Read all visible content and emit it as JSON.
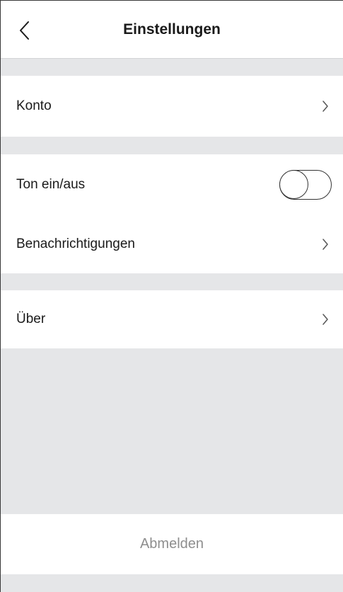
{
  "header": {
    "title": "Einstellungen"
  },
  "sections": {
    "account": {
      "label": "Konto"
    },
    "sound": {
      "label": "Ton ein/aus",
      "enabled": false
    },
    "notifications": {
      "label": "Benachrichtigungen"
    },
    "about": {
      "label": "Über"
    }
  },
  "logout": {
    "label": "Abmelden"
  },
  "icons": {
    "back": "chevron-left-icon",
    "row_arrow": "chevron-right-icon"
  },
  "colors": {
    "background": "#e5e6e8",
    "surface": "#ffffff",
    "text": "#1a1a1a",
    "muted_text": "#8e8e8e"
  }
}
